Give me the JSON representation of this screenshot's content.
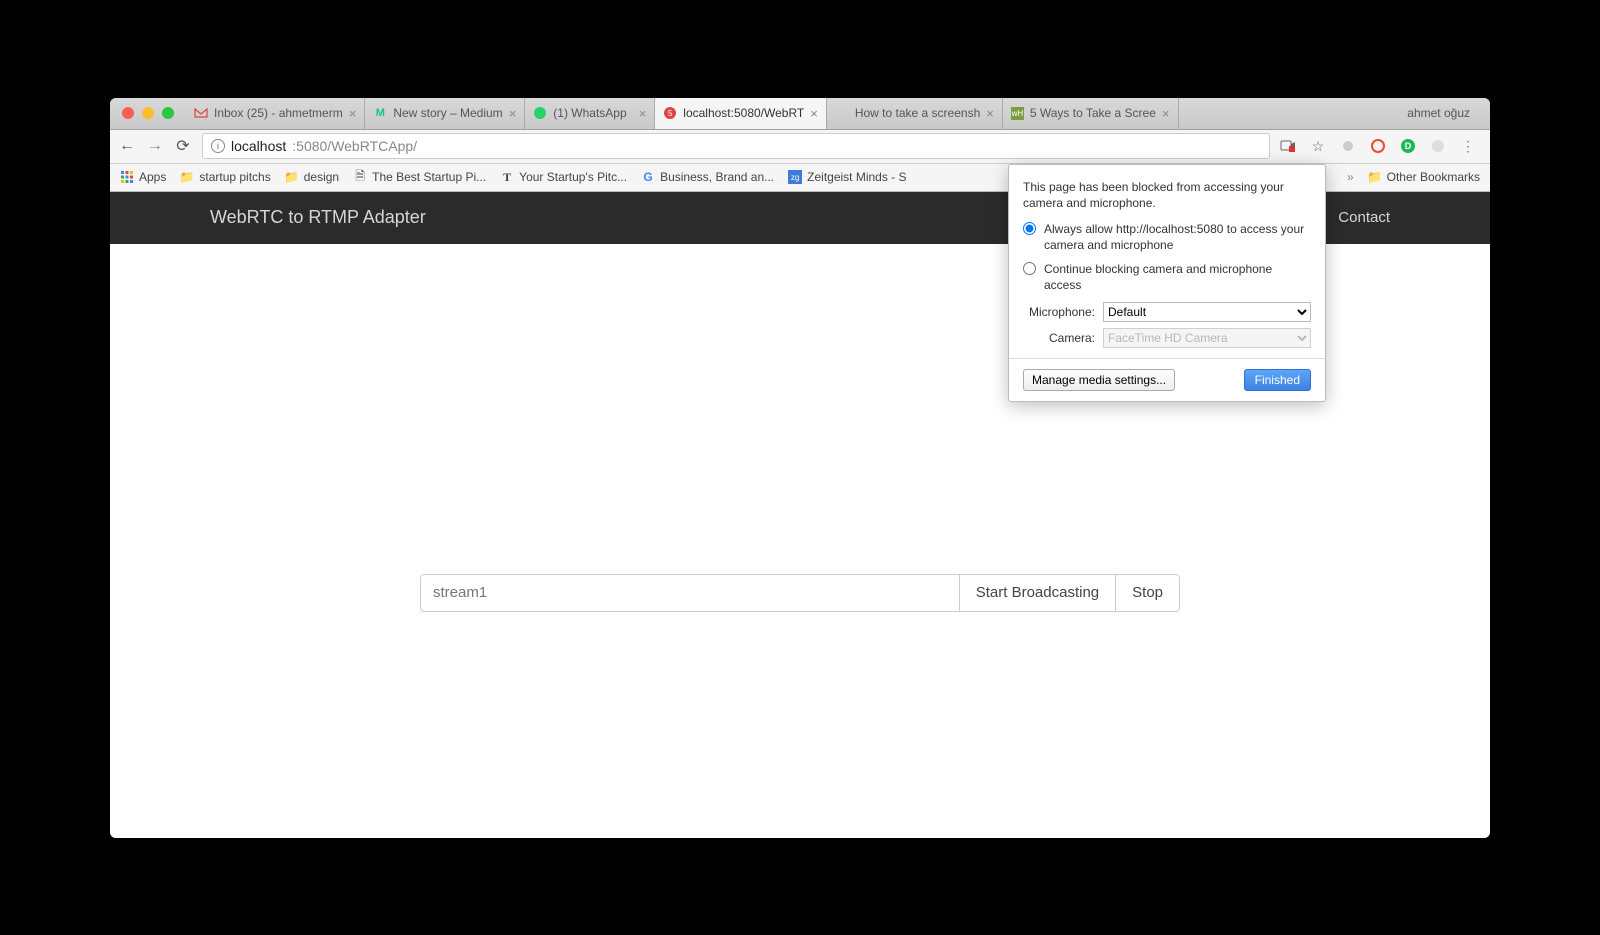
{
  "profile_name": "ahmet oğuz",
  "tabs": [
    {
      "title": "Inbox (25) - ahmetmerm",
      "icon": "gmail"
    },
    {
      "title": "New story – Medium",
      "icon": "medium"
    },
    {
      "title": "(1) WhatsApp",
      "icon": "whatsapp"
    },
    {
      "title": "localhost:5080/WebRT",
      "icon": "local",
      "active": true
    },
    {
      "title": "How to take a screensh",
      "icon": "apple"
    },
    {
      "title": "5 Ways to Take a Scree",
      "icon": "wikihow"
    }
  ],
  "omnibox": {
    "host": "localhost",
    "path": ":5080/WebRTCApp/"
  },
  "bookmarks": [
    {
      "label": "Apps",
      "icon": "apps"
    },
    {
      "label": "startup pitchs",
      "icon": "folder"
    },
    {
      "label": "design",
      "icon": "folder"
    },
    {
      "label": "The Best Startup Pi...",
      "icon": "page"
    },
    {
      "label": "Your Startup's Pitc...",
      "icon": "T"
    },
    {
      "label": "Business, Brand an...",
      "icon": "G"
    },
    {
      "label": "Zeitgeist Minds - S",
      "icon": "zg"
    }
  ],
  "other_bookmarks": "Other Bookmarks",
  "page": {
    "title": "WebRTC to RTMP Adapter",
    "nav_contact": "Contact",
    "stream_value": "stream1",
    "start_btn": "Start Broadcasting",
    "stop_btn": "Stop"
  },
  "popup": {
    "message": "This page has been blocked from accessing your camera and microphone.",
    "option_allow": "Always allow http://localhost:5080 to access your camera and microphone",
    "option_block": "Continue blocking camera and microphone access",
    "mic_label": "Microphone:",
    "mic_value": "Default",
    "cam_label": "Camera:",
    "cam_value": "FaceTime HD Camera",
    "manage": "Manage media settings...",
    "finished": "Finished"
  }
}
